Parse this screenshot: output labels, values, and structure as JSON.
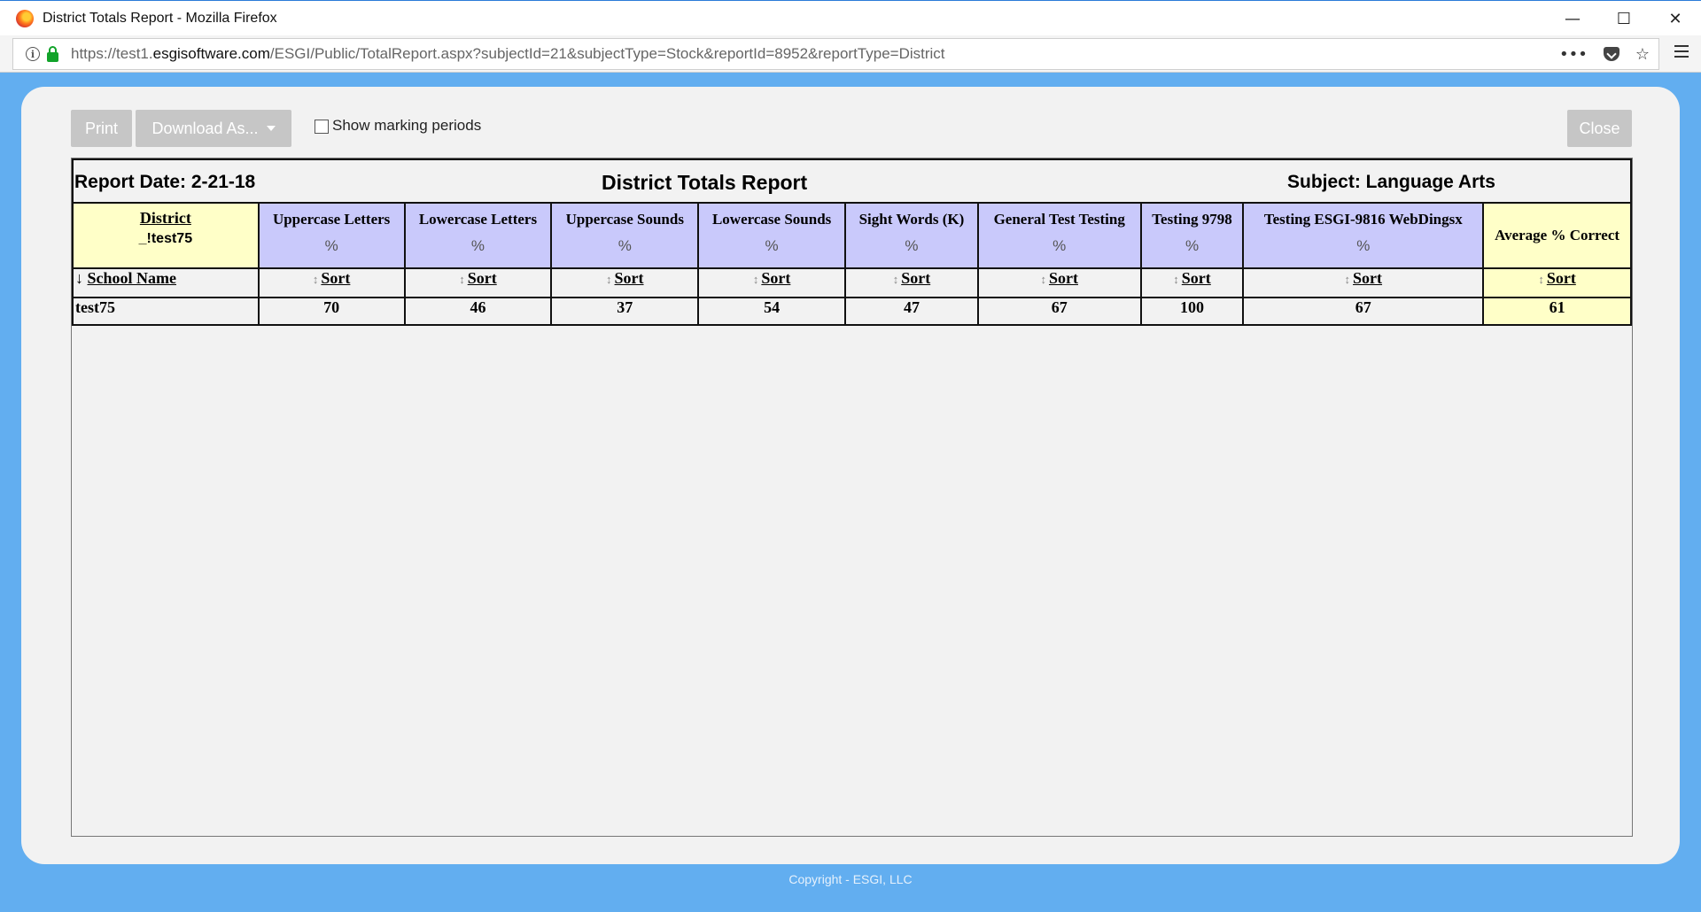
{
  "window": {
    "title": "District Totals Report - Mozilla Firefox",
    "controls": {
      "minimize": "—",
      "maximize": "☐",
      "close": "✕"
    }
  },
  "browser": {
    "url_prefix": "https://test1.",
    "url_domain": "esgisoftware.com",
    "url_path": "/ESGI/Public/TotalReport.aspx?subjectId=21&subjectType=Stock&reportId=8952&reportType=District",
    "icons": [
      "info-icon",
      "lock-icon",
      "page-actions-icon",
      "pocket-icon",
      "bookmark-star-icon",
      "menu-icon"
    ]
  },
  "toolbar": {
    "print_label": "Print",
    "download_label": "Download As...",
    "marking_label": "Show marking periods",
    "marking_checked": false,
    "close_label": "Close"
  },
  "report": {
    "date": "Report Date: 2-21-18",
    "title": "District Totals Report",
    "subject": "Subject: Language Arts",
    "district_label": "District",
    "district_value": "_!test75",
    "school_col_label": "School Name",
    "school_sort_arrow": "↓",
    "sort_label": "Sort",
    "sort_arrow": "↕",
    "pct_label": "%",
    "tests": [
      {
        "name": "Uppercase Letters",
        "value": "70"
      },
      {
        "name": "Lowercase Letters",
        "value": "46"
      },
      {
        "name": "Uppercase Sounds",
        "value": "37"
      },
      {
        "name": "Lowercase Sounds",
        "value": "54"
      },
      {
        "name": "Sight Words (K)",
        "value": "47"
      },
      {
        "name": "General Test Testing",
        "value": "67"
      },
      {
        "name": "Testing 9798",
        "value": "100"
      },
      {
        "name": "Testing ESGI-9816 WebDingsx",
        "value": "67"
      }
    ],
    "avg_label": "Average % Correct",
    "rows": [
      {
        "school": "test75",
        "average": "61"
      }
    ]
  },
  "colors": {
    "test_header_bg": "#c9c9fb",
    "highlight_bg": "#ffffc8",
    "page_bg": "#62aef0"
  },
  "footer": {
    "text": "Copyright - ESGI, LLC"
  }
}
